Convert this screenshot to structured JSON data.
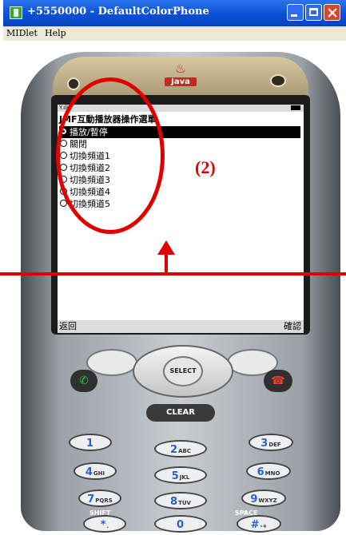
{
  "window": {
    "title": "+5550000 - DefaultColorPhone"
  },
  "menubar": {
    "items": [
      "MIDlet",
      "Help"
    ]
  },
  "phone": {
    "java_logo": "Java",
    "list_title": "JMF互動播放器操作選單",
    "items": [
      {
        "label": "播放/暫停",
        "selected": true
      },
      {
        "label": "關閉",
        "selected": false
      },
      {
        "label": "切換頻道1",
        "selected": false
      },
      {
        "label": "切換頻道2",
        "selected": false
      },
      {
        "label": "切換頻道3",
        "selected": false
      },
      {
        "label": "切換頻道4",
        "selected": false
      },
      {
        "label": "切換頻道5",
        "selected": false
      }
    ],
    "softkey_left": "返回",
    "softkey_right": "確認",
    "select_label": "SELECT",
    "clear_label": "CLEAR",
    "keys": [
      {
        "num": "1",
        "letters": ""
      },
      {
        "num": "2",
        "letters": "ABC"
      },
      {
        "num": "3",
        "letters": "DEF"
      },
      {
        "num": "4",
        "letters": "GHI"
      },
      {
        "num": "5",
        "letters": "JKL"
      },
      {
        "num": "6",
        "letters": "MNO"
      },
      {
        "num": "7",
        "letters": "PQRS"
      },
      {
        "num": "8",
        "letters": "TUV"
      },
      {
        "num": "9",
        "letters": "WXYZ"
      },
      {
        "num": "*",
        "letters": "."
      },
      {
        "num": "0",
        "letters": ""
      },
      {
        "num": "#",
        "letters": "-+"
      }
    ],
    "shift_label": "SHIFT",
    "space_label": "SPACE"
  },
  "annotation": {
    "label": "(2)",
    "color": "#e00000"
  }
}
